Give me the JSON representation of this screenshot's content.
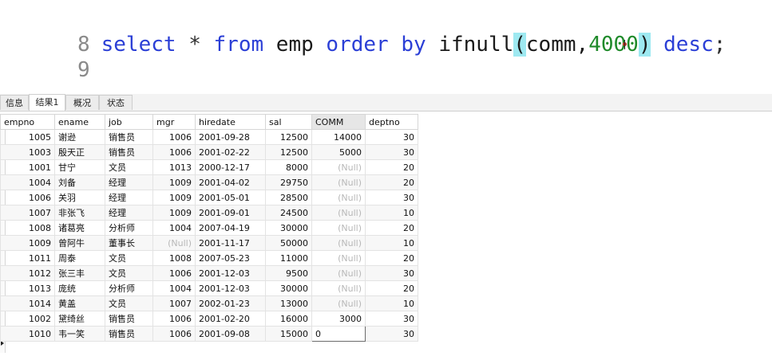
{
  "editor": {
    "lines": [
      {
        "number": "8",
        "tokens": {
          "select": "select",
          "star": "*",
          "from": "from",
          "table": "emp",
          "order": "order",
          "by": "by",
          "func": "ifnull",
          "open": "(",
          "arg": "comm,",
          "value": "4000",
          "close": ")",
          "desc": "desc",
          "semi": ";"
        }
      },
      {
        "number": "9"
      }
    ]
  },
  "tabs": [
    {
      "label": "信息",
      "active": false
    },
    {
      "label": "结果1",
      "active": true
    },
    {
      "label": "概况",
      "active": false
    },
    {
      "label": "状态",
      "active": false
    }
  ],
  "grid": {
    "columns": [
      "empno",
      "ename",
      "job",
      "mgr",
      "hiredate",
      "sal",
      "COMM",
      "deptno"
    ],
    "selected_column": "COMM",
    "null_text": "(Null)",
    "rows": [
      [
        "1005",
        "谢逊",
        "销售员",
        "1006",
        "2001-09-28",
        "12500",
        "14000",
        "30"
      ],
      [
        "1003",
        "殷天正",
        "销售员",
        "1006",
        "2001-02-22",
        "12500",
        "5000",
        "30"
      ],
      [
        "1001",
        "甘宁",
        "文员",
        "1013",
        "2000-12-17",
        "8000",
        "(Null)",
        "20"
      ],
      [
        "1004",
        "刘备",
        "经理",
        "1009",
        "2001-04-02",
        "29750",
        "(Null)",
        "20"
      ],
      [
        "1006",
        "关羽",
        "经理",
        "1009",
        "2001-05-01",
        "28500",
        "(Null)",
        "30"
      ],
      [
        "1007",
        "非张飞",
        "经理",
        "1009",
        "2001-09-01",
        "24500",
        "(Null)",
        "10"
      ],
      [
        "1008",
        "诸葛亮",
        "分析师",
        "1004",
        "2007-04-19",
        "30000",
        "(Null)",
        "20"
      ],
      [
        "1009",
        "曾阿牛",
        "董事长",
        "(Null)",
        "2001-11-17",
        "50000",
        "(Null)",
        "10"
      ],
      [
        "1011",
        "周泰",
        "文员",
        "1008",
        "2007-05-23",
        "11000",
        "(Null)",
        "20"
      ],
      [
        "1012",
        "张三丰",
        "文员",
        "1006",
        "2001-12-03",
        "9500",
        "(Null)",
        "30"
      ],
      [
        "1013",
        "庞统",
        "分析师",
        "1004",
        "2001-12-03",
        "30000",
        "(Null)",
        "20"
      ],
      [
        "1014",
        "黄盖",
        "文员",
        "1007",
        "2002-01-23",
        "13000",
        "(Null)",
        "10"
      ],
      [
        "1002",
        "黛绮丝",
        "销售员",
        "1006",
        "2001-02-20",
        "16000",
        "3000",
        "30"
      ],
      [
        "1010",
        "韦一笑",
        "销售员",
        "1006",
        "2001-09-08",
        "15000",
        "0",
        "30"
      ]
    ]
  }
}
